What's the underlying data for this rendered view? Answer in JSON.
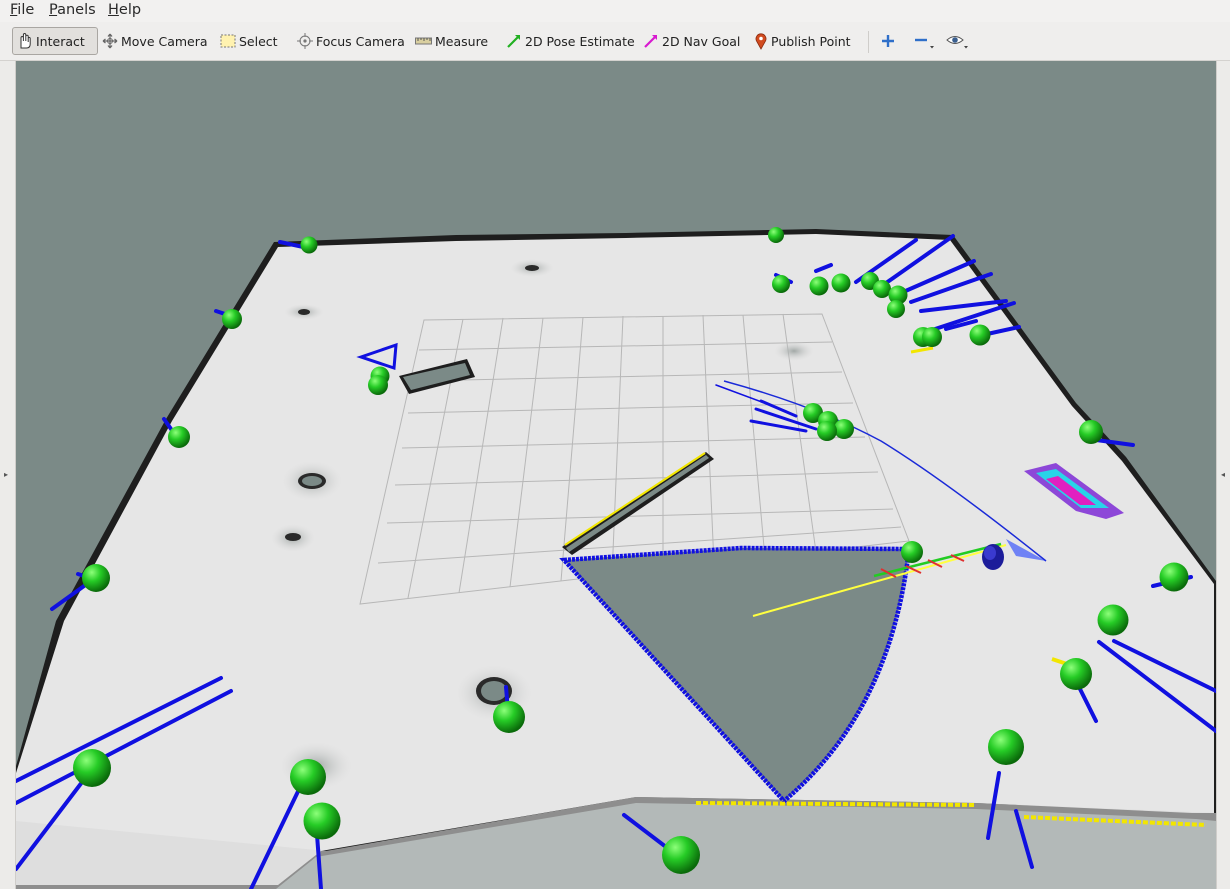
{
  "menu": {
    "file": "File",
    "panels": "Panels",
    "help": "Help"
  },
  "toolbar": {
    "interact": "Interact",
    "move_camera": "Move Camera",
    "select": "Select",
    "focus_camera": "Focus Camera",
    "measure": "Measure",
    "pose_estimate": "2D Pose Estimate",
    "nav_goal": "2D Nav Goal",
    "publish_point": "Publish Point"
  },
  "icons": {
    "add": "plus-icon",
    "remove": "minus-icon",
    "view": "eye-icon"
  },
  "colors": {
    "background": "#7b8a87",
    "map_free": "#e6e6e6",
    "laser_scan": "#1010e0",
    "markers": "#22cc22",
    "path_local": "#ffff40",
    "pose_estimate_arrow": "#22cc22",
    "nav_goal_arrow": "#e020c0"
  }
}
